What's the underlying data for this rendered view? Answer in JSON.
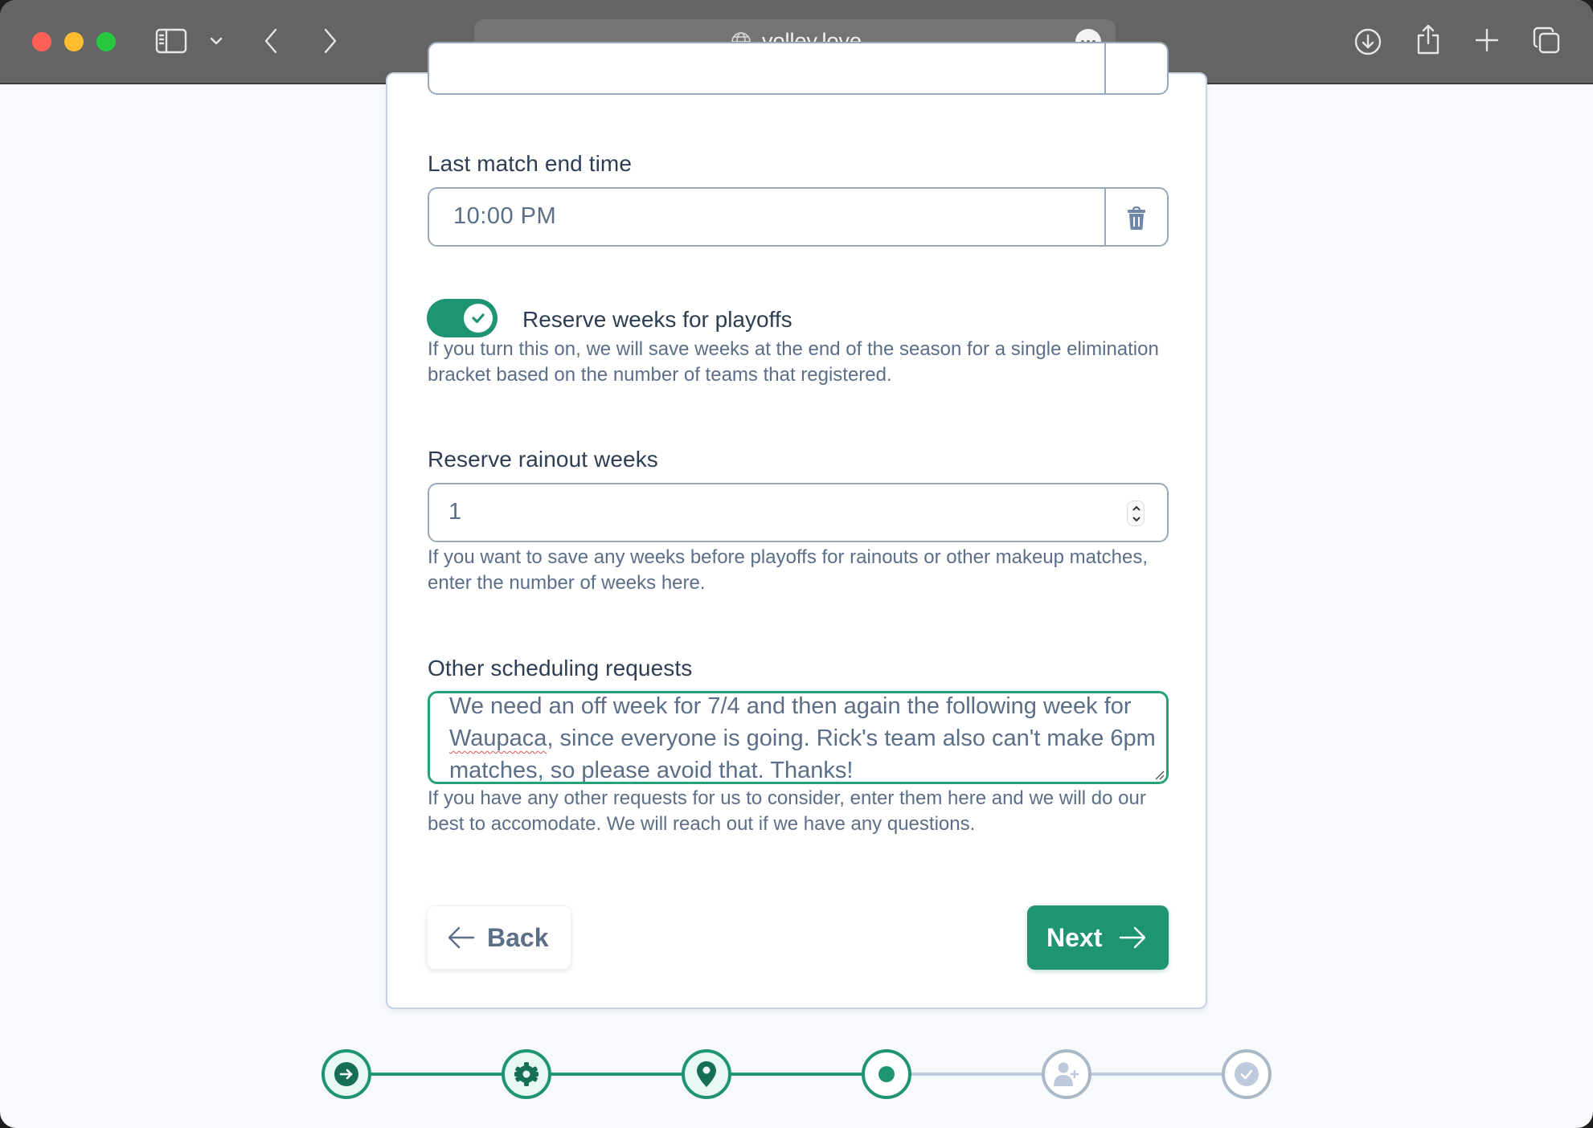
{
  "browser": {
    "url": "volley.love",
    "icons": {
      "sidebar": "sidebar-icon",
      "tab_group_menu": "chevron-down-icon",
      "back": "chevron-left-icon",
      "forward": "chevron-right-icon",
      "site": "globe-icon",
      "page_menu": "ellipsis-icon",
      "downloads": "download-icon",
      "share": "share-icon",
      "new_tab": "plus-icon",
      "tabs_overview": "tabs-icon"
    }
  },
  "form": {
    "last_match_end_time": {
      "label": "Last match end time",
      "value": "10:00 PM",
      "clear_icon": "trash-icon"
    },
    "reserve_playoffs": {
      "label": "Reserve weeks for playoffs",
      "checked": true,
      "help": "If you turn this on, we will save weeks at the end of the season for a single elimination bracket based on the number of teams that registered."
    },
    "rainout_weeks": {
      "label": "Reserve rainout weeks",
      "value": "1",
      "help": "If you want to save any weeks before playoffs for rainouts or other makeup matches, enter the number of weeks here."
    },
    "other_requests": {
      "label": "Other scheduling requests",
      "value_before": "We need an off week for 7/4 and then again the following week for ",
      "value_misspelled": "Waupaca",
      "value_after": ", since everyone is going. Rick's team also can't make 6pm matches, so please avoid that. Thanks!",
      "help": "If you have any other requests for us to consider, enter them here and we will do our best to accomodate. We will reach out if we have any questions."
    },
    "back_label": "Back",
    "next_label": "Next"
  },
  "colors": {
    "accent": "#1e9472",
    "accent_dark": "#166e55",
    "text_primary": "#2d3d52",
    "text_muted": "#5b6e88",
    "border": "#98a9bd",
    "inactive": "#aab8c8"
  },
  "steps": {
    "current_index": 3,
    "items": [
      {
        "icon": "arrow-right-circle-icon",
        "state": "done"
      },
      {
        "icon": "gear-icon",
        "state": "done"
      },
      {
        "icon": "map-pin-icon",
        "state": "done"
      },
      {
        "icon": "dot-icon",
        "state": "current"
      },
      {
        "icon": "user-plus-icon",
        "state": "todo"
      },
      {
        "icon": "check-circle-icon",
        "state": "todo"
      }
    ]
  }
}
